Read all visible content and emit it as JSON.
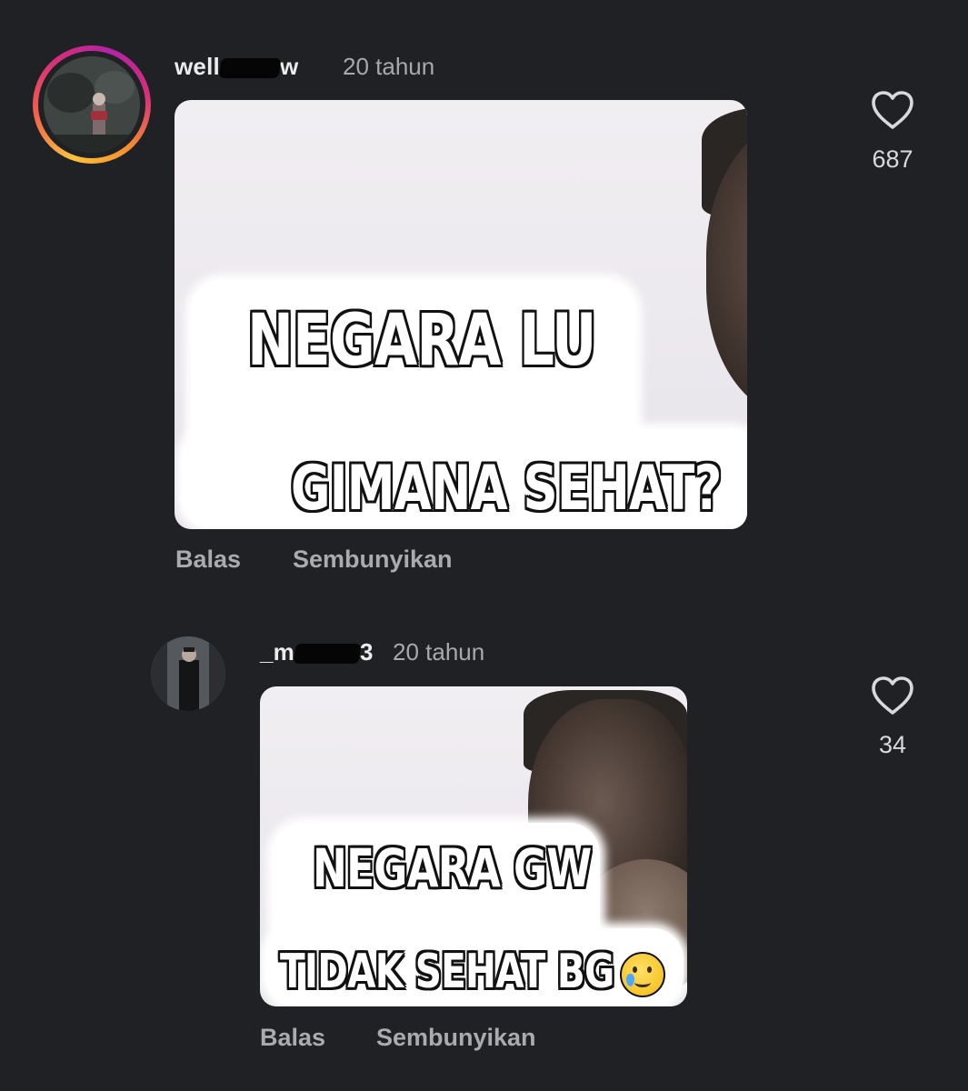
{
  "comments": [
    {
      "username_start": "well",
      "username_end": "w",
      "time": "20 tahun",
      "meme_line1": "NEGARA LU",
      "meme_line2": "GIMANA SEHAT?",
      "reply_label": "Balas",
      "hide_label": "Sembunyikan",
      "likes": "687"
    },
    {
      "username_start": "_m",
      "username_end": "3",
      "time": "20 tahun",
      "meme_line1": "NEGARA GW",
      "meme_line2": "TIDAK SEHAT BG",
      "reply_label": "Balas",
      "hide_label": "Sembunyikan",
      "likes": "34"
    }
  ],
  "icons": {
    "like": "heart-outline-icon",
    "emoji": "smiling-face-with-tear-emoji"
  },
  "colors": {
    "background": "#1f2124",
    "secondary_text": "#a7a9ad",
    "story_ring_start": "#f9c23c",
    "story_ring_end": "#b323a8"
  }
}
